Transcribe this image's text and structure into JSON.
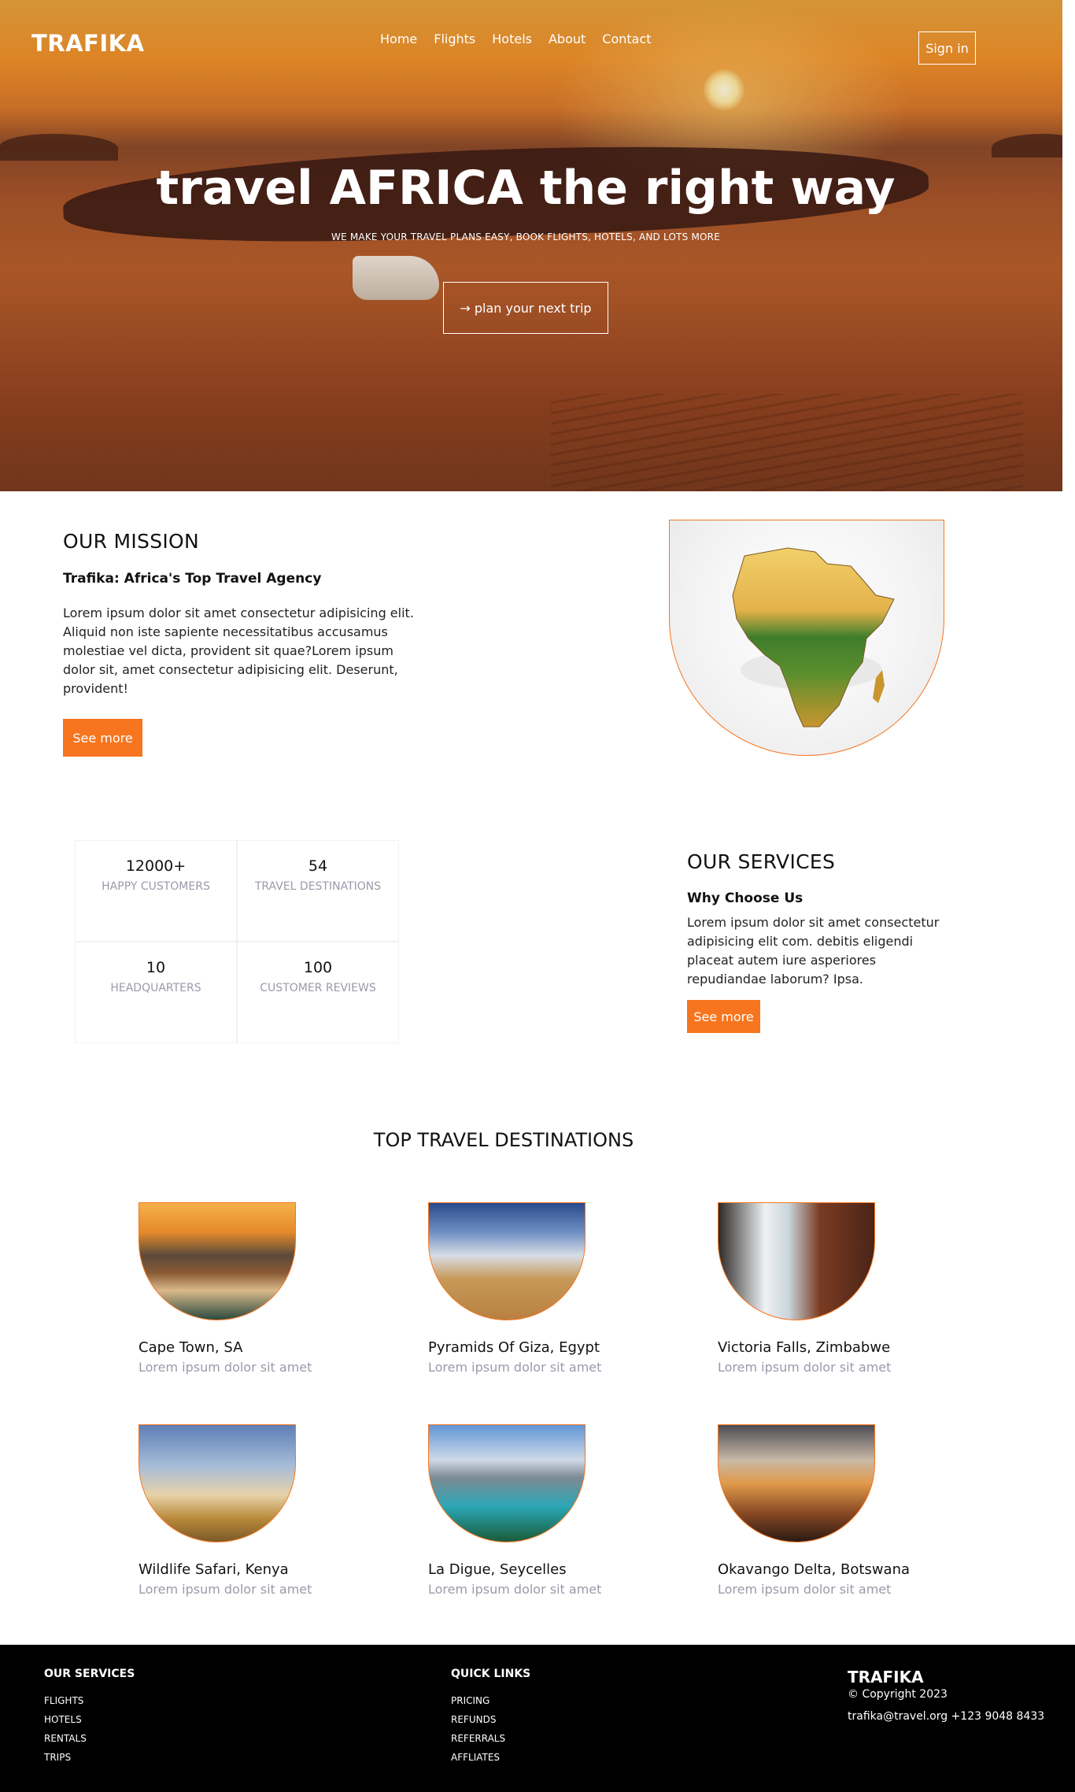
{
  "header": {
    "logo": "TRAFIKA",
    "nav": [
      "Home",
      "Flights",
      "Hotels",
      "About",
      "Contact"
    ],
    "sign_in": "Sign in"
  },
  "hero": {
    "title": "travel AFRICA the right way",
    "subtitle": "WE MAKE YOUR TRAVEL PLANS EASY, BOOK FLIGHTS, HOTELS, AND LOTS MORE",
    "cta": "→ plan your next trip"
  },
  "mission": {
    "title": "OUR MISSION",
    "subtitle": "Trafika: Africa's Top Travel Agency",
    "body": "Lorem ipsum dolor sit amet consectetur adipisicing elit. Aliquid non iste sapiente necessitatibus accusamus molestiae vel dicta, provident sit quae?Lorem ipsum dolor sit, amet consectetur adipisicing elit. Deserunt, provident!",
    "button": "See more"
  },
  "stats": [
    {
      "value": "12000+",
      "label": "HAPPY CUSTOMERS"
    },
    {
      "value": "54",
      "label": "TRAVEL DESTINATIONS"
    },
    {
      "value": "10",
      "label": "HEADQUARTERS"
    },
    {
      "value": "100",
      "label": "CUSTOMER REVIEWS"
    }
  ],
  "services": {
    "title": "OUR SERVICES",
    "subtitle": "Why Choose Us",
    "body": "Lorem ipsum dolor sit amet consectetur adipisicing elit com. debitis eligendi placeat autem iure asperiores repudiandae laborum? Ipsa.",
    "button": "See more"
  },
  "destinations": {
    "title": "TOP TRAVEL DESTINATIONS",
    "items": [
      {
        "name": "Cape Town, SA",
        "desc": "Lorem ipsum dolor sit amet"
      },
      {
        "name": "Pyramids Of Giza, Egypt",
        "desc": "Lorem ipsum dolor sit amet"
      },
      {
        "name": "Victoria Falls, Zimbabwe",
        "desc": "Lorem ipsum dolor sit amet"
      },
      {
        "name": "Wildlife Safari, Kenya",
        "desc": "Lorem ipsum dolor sit amet"
      },
      {
        "name": "La Digue, Seycelles",
        "desc": "Lorem ipsum dolor sit amet"
      },
      {
        "name": "Okavango Delta, Botswana",
        "desc": "Lorem ipsum dolor sit amet"
      }
    ]
  },
  "footer": {
    "services_title": "OUR SERVICES",
    "services": [
      "FLIGHTS",
      "HOTELS",
      "RENTALS",
      "TRIPS"
    ],
    "links_title": "QUICK LINKS",
    "links": [
      "PRICING",
      "REFUNDS",
      "REFERRALS",
      "AFFLIATES"
    ],
    "brand": "TRAFIKA",
    "copyright": "© Copyright 2023",
    "contact": "trafika@travel.org +123 9048 8433"
  },
  "colors": {
    "accent": "#f7751f",
    "muted": "#9a9aaa",
    "footer_bg": "#000000"
  }
}
